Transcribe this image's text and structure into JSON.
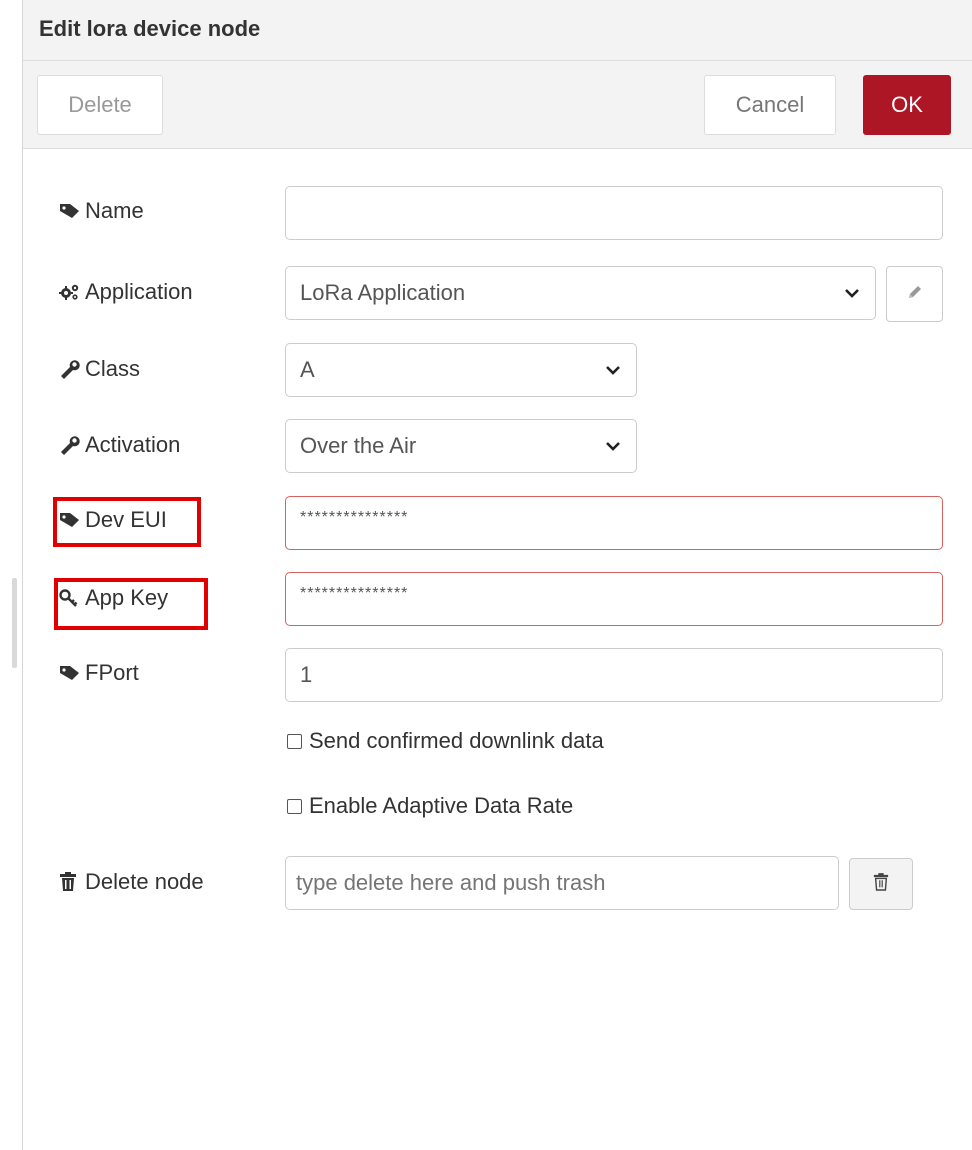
{
  "dialog": {
    "title": "Edit lora device node"
  },
  "toolbar": {
    "delete_label": "Delete",
    "cancel_label": "Cancel",
    "ok_label": "OK",
    "ok_color": "#ad1625"
  },
  "form": {
    "name": {
      "label": "Name",
      "value": "",
      "icon": "tag-icon"
    },
    "application": {
      "label": "Application",
      "value": "LoRa Application",
      "icon": "cogs-icon",
      "edit_icon": "pencil-icon"
    },
    "class": {
      "label": "Class",
      "value": "A",
      "icon": "wrench-icon"
    },
    "activation": {
      "label": "Activation",
      "value": "Over the Air",
      "icon": "wrench-icon"
    },
    "dev_eui": {
      "label": "Dev EUI",
      "value": "***************",
      "icon": "tag-icon",
      "state": "error"
    },
    "app_key": {
      "label": "App Key",
      "value": "***************",
      "icon": "key-icon",
      "state": "error"
    },
    "fport": {
      "label": "FPort",
      "value": "1",
      "icon": "tag-icon"
    },
    "confirmed_downlink": {
      "label": "Send confirmed downlink data",
      "checked": false
    },
    "adaptive_data_rate": {
      "label": "Enable Adaptive Data Rate",
      "checked": false
    },
    "delete_node": {
      "label": "Delete node",
      "placeholder": "type delete here and push trash",
      "icon": "trash-icon"
    }
  },
  "colors": {
    "highlight": "#e00000",
    "error_border": "#d6615e"
  }
}
